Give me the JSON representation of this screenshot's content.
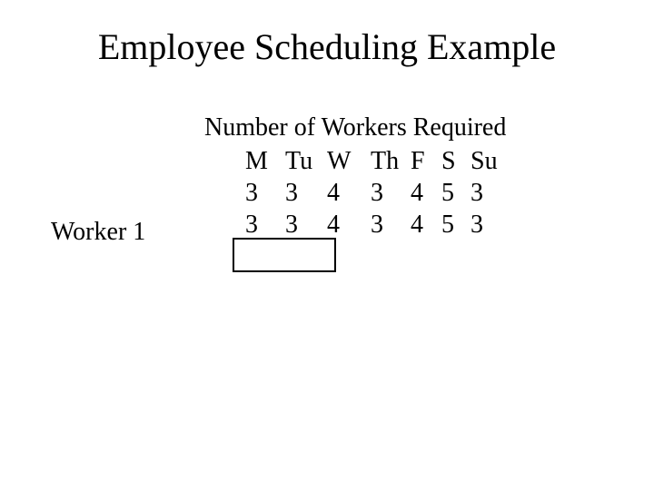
{
  "title": "Employee Scheduling Example",
  "subtitle": "Number of Workers Required",
  "headers": {
    "m": "M",
    "tu": "Tu",
    "w": "W",
    "th": "Th",
    "f": "F",
    "s": "S",
    "su": "Su"
  },
  "row1": {
    "m": "3",
    "tu": "3",
    "w": "4",
    "th": "3",
    "f": "4",
    "s": "5",
    "su": "3"
  },
  "row2": {
    "m": "3",
    "tu": "3",
    "w": "4",
    "th": "3",
    "f": "4",
    "s": "5",
    "su": "3"
  },
  "worker_label": "Worker 1",
  "chart_data": {
    "type": "table",
    "title": "Number of Workers Required",
    "columns": [
      "M",
      "Tu",
      "W",
      "Th",
      "F",
      "S",
      "Su"
    ],
    "rows": [
      {
        "label": "",
        "values": [
          3,
          3,
          4,
          3,
          4,
          5,
          3
        ]
      },
      {
        "label": "Worker 1",
        "values": [
          3,
          3,
          4,
          3,
          4,
          5,
          3
        ]
      }
    ]
  }
}
